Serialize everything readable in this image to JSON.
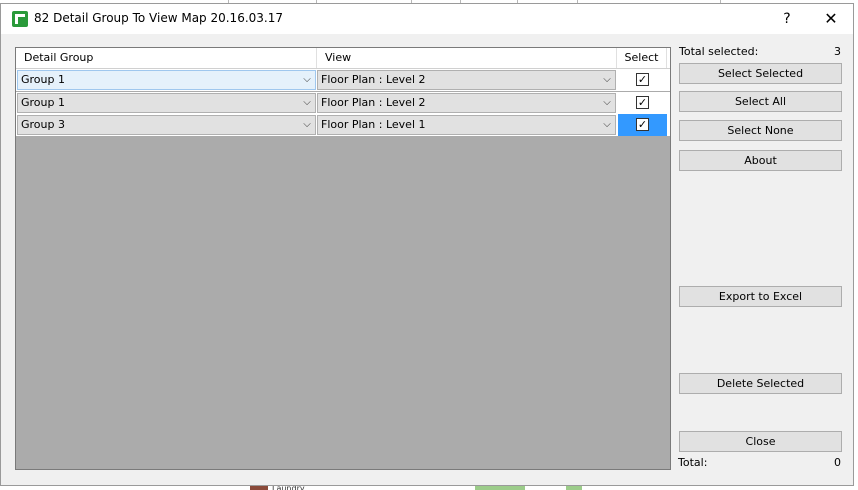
{
  "window": {
    "title": "82 Detail Group To View Map 20.16.03.17",
    "help_glyph": "?",
    "close_glyph": "✕",
    "app_icon": "green-app-icon"
  },
  "grid": {
    "columns": [
      "Detail Group",
      "View",
      "Select"
    ],
    "rows": [
      {
        "group": "Group 1",
        "view": "Floor Plan : Level 2",
        "selected": true
      },
      {
        "group": "Group 1",
        "view": "Floor Plan : Level 2",
        "selected": true
      },
      {
        "group": "Group 3",
        "view": "Floor Plan : Level 1",
        "selected": true
      }
    ],
    "dropdown_glyph": "⌵",
    "check_glyph": "✓"
  },
  "side": {
    "total_selected_label": "Total selected:",
    "total_selected_value": "3",
    "total_label": "Total:",
    "total_value": "0",
    "buttons": {
      "select_selected": "Select Selected",
      "select_all": "Select All",
      "select_none": "Select None",
      "about": "About",
      "export_excel": "Export to Excel",
      "delete_selected": "Delete Selected",
      "close": "Close"
    }
  },
  "background": {
    "bottom_text": "Laundry"
  },
  "colors": {
    "selection": "#3399ff",
    "grid_background": "#ababab",
    "dialog_background": "#f0f0f0"
  }
}
